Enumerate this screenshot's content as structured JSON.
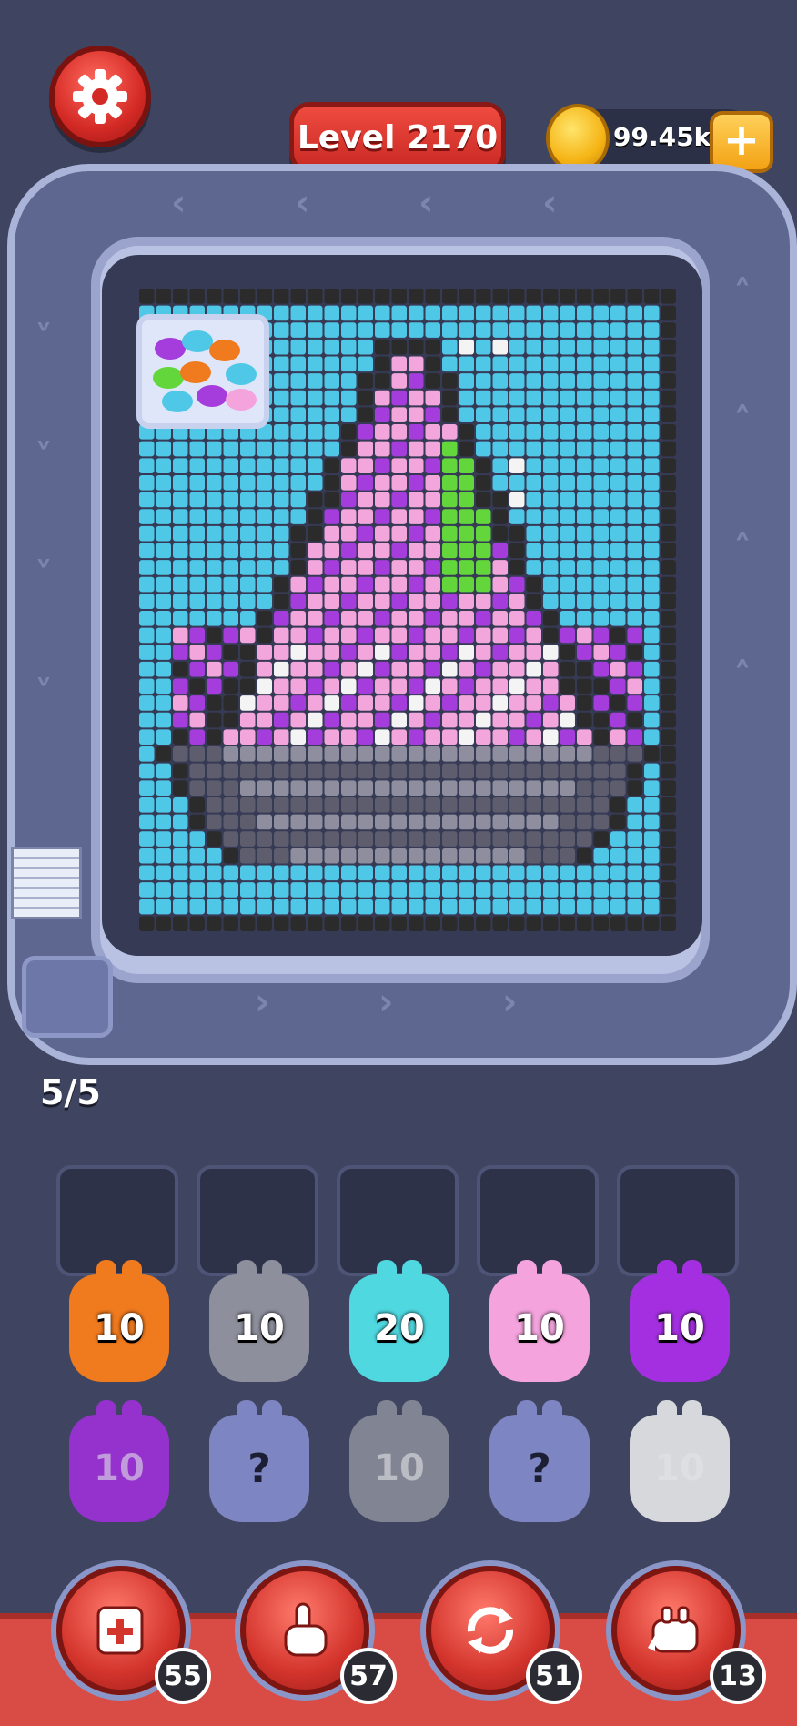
{
  "header": {
    "settings_icon": "gear-icon",
    "level_label": "Level 2170",
    "coins": "99.45k",
    "coin_plus_label": "+"
  },
  "board": {
    "queue_counter": "5/5",
    "colors": {
      "sky": "#4fc8e8",
      "outline": "#2b2b2b",
      "purple": "#a43ddc",
      "pink": "#f2a6dc",
      "white": "#f4f4f4",
      "green": "#62d63a",
      "gray": "#8e8e9e",
      "dark_gray": "#5d5d6e"
    }
  },
  "pigs": [
    {
      "label": "10",
      "color": "#f07a1e",
      "faded": false
    },
    {
      "label": "10",
      "color": "#8d8f9c",
      "faded": false
    },
    {
      "label": "20",
      "color": "#4fd8e0",
      "faded": false
    },
    {
      "label": "10",
      "color": "#f4a3dd",
      "faded": false
    },
    {
      "label": "10",
      "color": "#a42fe0",
      "faded": false
    },
    {
      "label": "10",
      "color": "#a42fe0",
      "faded": true
    },
    {
      "label": "?",
      "color": "#7d85c2",
      "faded": false
    },
    {
      "label": "10",
      "color": "#8d8f9c",
      "faded": true
    },
    {
      "label": "?",
      "color": "#7d85c2",
      "faded": false
    },
    {
      "label": "10",
      "color": "#f2f2f2",
      "faded": true
    }
  ],
  "boosters": [
    {
      "icon": "add-slot-icon",
      "count": "55"
    },
    {
      "icon": "hand-tap-icon",
      "count": "57"
    },
    {
      "icon": "shuffle-icon",
      "count": "51"
    },
    {
      "icon": "pig-train-icon",
      "count": "13"
    }
  ]
}
